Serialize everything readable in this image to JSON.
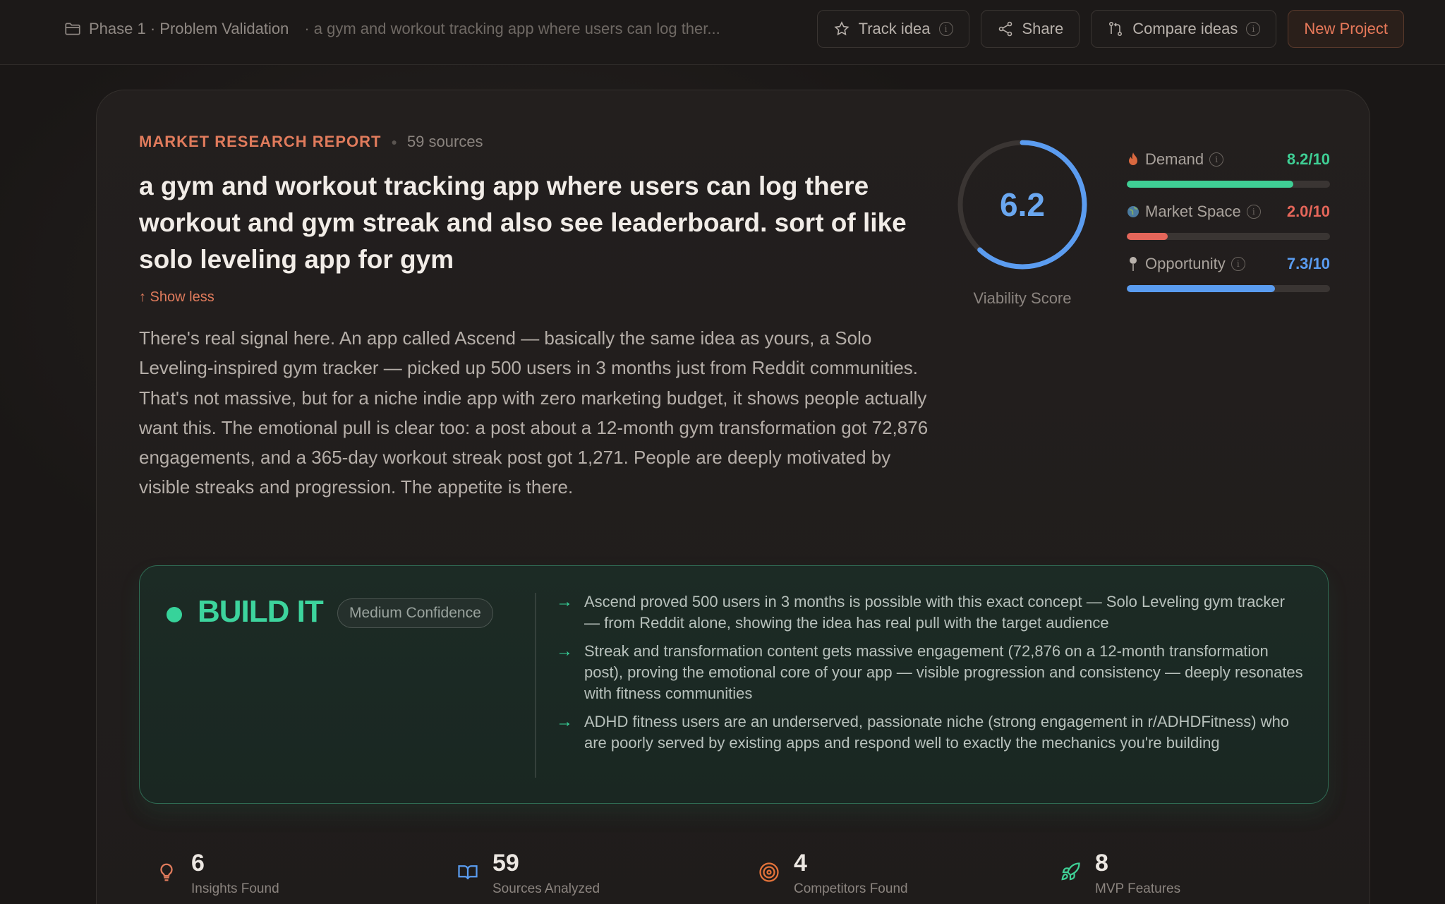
{
  "topbar": {
    "breadcrumb": "Phase 1 · Problem Validation",
    "idea_crumb": "· a gym and workout tracking app where users can log ther...",
    "track_label": "Track idea",
    "share_label": "Share",
    "compare_label": "Compare ideas",
    "new_label": "New Project"
  },
  "report": {
    "eyebrow": "MARKET RESEARCH REPORT",
    "sources": "59 sources",
    "title": "a gym and workout tracking app where users can log there workout and gym streak and also see leaderboard. sort of like solo leveling app for gym",
    "show_less": "↑ Show less",
    "summary": "There's real signal here. An app called Ascend — basically the same idea as yours, a Solo Leveling-inspired gym tracker — picked up 500 users in 3 months just from Reddit communities. That's not massive, but for a niche indie app with zero marketing budget, it shows people actually want this. The emotional pull is clear too: a post about a 12-month gym transformation got 72,876 engagements, and a 365-day workout streak post got 1,271. People are deeply motivated by visible streaks and progression. The appetite is there."
  },
  "score": {
    "value": "6.2",
    "fraction": 0.62,
    "label": "Viability Score",
    "color": "#5b9cf0"
  },
  "metrics": [
    {
      "label": "Demand",
      "value": "8.2/10",
      "fraction": 0.82,
      "color": "#3fcf95",
      "icon": "flame-icon"
    },
    {
      "label": "Market Space",
      "value": "2.0/10",
      "fraction": 0.2,
      "color": "#e5665a",
      "icon": "globe-icon"
    },
    {
      "label": "Opportunity",
      "value": "7.3/10",
      "fraction": 0.73,
      "color": "#5a9cf0",
      "icon": "pin-icon"
    }
  ],
  "verdict": {
    "title": "BUILD IT",
    "confidence": "Medium Confidence",
    "points": [
      "Ascend proved 500 users in 3 months is possible with this exact concept — Solo Leveling gym tracker — from Reddit alone, showing the idea has real pull with the target audience",
      "Streak and transformation content gets massive engagement (72,876 on a 12-month transformation post), proving the emotional core of your app — visible progression and consistency — deeply resonates with fitness communities",
      "ADHD fitness users are an underserved, passionate niche (strong engagement in r/ADHDFitness) who are poorly served by existing apps and respond well to exactly the mechanics you're building"
    ]
  },
  "stats": [
    {
      "number": "6",
      "label": "Insights Found",
      "icon": "lightbulb-icon"
    },
    {
      "number": "59",
      "label": "Sources Analyzed",
      "icon": "book-icon"
    },
    {
      "number": "4",
      "label": "Competitors Found",
      "icon": "target-icon"
    },
    {
      "number": "8",
      "label": "MVP Features",
      "icon": "rocket-icon"
    }
  ]
}
